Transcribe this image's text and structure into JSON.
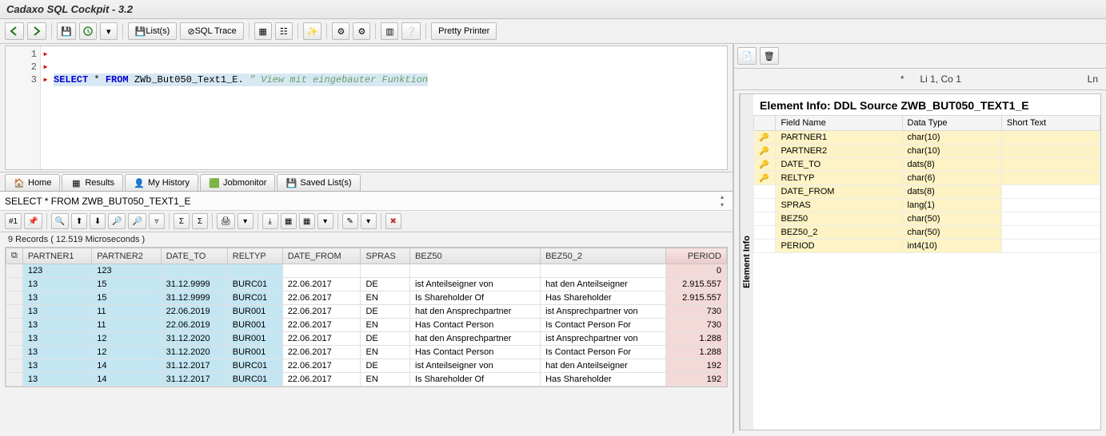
{
  "title": "Cadaxo SQL Cockpit - 3.2",
  "toolbar": {
    "lists": "List(s)",
    "sqltrace": "SQL Trace",
    "pretty": "Pretty Printer"
  },
  "editor": {
    "lines": {
      "l1": "1",
      "l2": "2",
      "l3": "3"
    },
    "code3": {
      "kw1": "SELECT",
      "kw2": "FROM",
      "star": "*",
      "ident": "ZWb_But050_Text1_E",
      "dot": ".",
      "comment": "\" View mit eingebauter Funktion"
    }
  },
  "tabs": {
    "home": "Home",
    "results": "Results",
    "history": "My History",
    "jobmon": "Jobmonitor",
    "saved": "Saved List(s)"
  },
  "query": "SELECT * FROM ZWB_BUT050_TEXT1_E",
  "resultmeta": "9 Records ( 12.519 Microseconds )",
  "columns": [
    "PARTNER1",
    "PARTNER2",
    "DATE_TO",
    "RELTYP",
    "DATE_FROM",
    "SPRAS",
    "BEZ50",
    "BEZ50_2",
    "PERIOD"
  ],
  "rows": [
    {
      "p1": "123",
      "p2": "123",
      "dto": "",
      "rel": "",
      "dfr": "",
      "spr": "",
      "b1": "",
      "b2": "",
      "per": "0"
    },
    {
      "p1": "13",
      "p2": "15",
      "dto": "31.12.9999",
      "rel": "BURC01",
      "dfr": "22.06.2017",
      "spr": "DE",
      "b1": "ist Anteilseigner von",
      "b2": "hat den Anteilseigner",
      "per": "2.915.557"
    },
    {
      "p1": "13",
      "p2": "15",
      "dto": "31.12.9999",
      "rel": "BURC01",
      "dfr": "22.06.2017",
      "spr": "EN",
      "b1": "Is Shareholder Of",
      "b2": "Has Shareholder",
      "per": "2.915.557"
    },
    {
      "p1": "13",
      "p2": "11",
      "dto": "22.06.2019",
      "rel": "BUR001",
      "dfr": "22.06.2017",
      "spr": "DE",
      "b1": "hat den Ansprechpartner",
      "b2": "ist Ansprechpartner von",
      "per": "730"
    },
    {
      "p1": "13",
      "p2": "11",
      "dto": "22.06.2019",
      "rel": "BUR001",
      "dfr": "22.06.2017",
      "spr": "EN",
      "b1": "Has Contact Person",
      "b2": "Is Contact Person For",
      "per": "730"
    },
    {
      "p1": "13",
      "p2": "12",
      "dto": "31.12.2020",
      "rel": "BUR001",
      "dfr": "22.06.2017",
      "spr": "DE",
      "b1": "hat den Ansprechpartner",
      "b2": "ist Ansprechpartner von",
      "per": "1.288"
    },
    {
      "p1": "13",
      "p2": "12",
      "dto": "31.12.2020",
      "rel": "BUR001",
      "dfr": "22.06.2017",
      "spr": "EN",
      "b1": "Has Contact Person",
      "b2": "Is Contact Person For",
      "per": "1.288"
    },
    {
      "p1": "13",
      "p2": "14",
      "dto": "31.12.2017",
      "rel": "BURC01",
      "dfr": "22.06.2017",
      "spr": "DE",
      "b1": "ist Anteilseigner von",
      "b2": "hat den Anteilseigner",
      "per": "192"
    },
    {
      "p1": "13",
      "p2": "14",
      "dto": "31.12.2017",
      "rel": "BURC01",
      "dfr": "22.06.2017",
      "spr": "EN",
      "b1": "Is Shareholder Of",
      "b2": "Has Shareholder",
      "per": "192"
    }
  ],
  "pos": {
    "star": "*",
    "line": "Li 1, Co 1",
    "ln": "Ln"
  },
  "elinfo": {
    "label": "Element Info",
    "title": "Element Info: DDL Source ZWB_BUT050_TEXT1_E",
    "cols": [
      "Field Name",
      "Data Type",
      "Short Text"
    ],
    "fields": [
      {
        "name": "PARTNER1",
        "dtype": "char(10)",
        "key": true
      },
      {
        "name": "PARTNER2",
        "dtype": "char(10)",
        "key": true
      },
      {
        "name": "DATE_TO",
        "dtype": "dats(8)",
        "key": true
      },
      {
        "name": "RELTYP",
        "dtype": "char(6)",
        "key": true
      },
      {
        "name": "DATE_FROM",
        "dtype": "dats(8)",
        "key": false
      },
      {
        "name": "SPRAS",
        "dtype": "lang(1)",
        "key": false
      },
      {
        "name": "BEZ50",
        "dtype": "char(50)",
        "key": false
      },
      {
        "name": "BEZ50_2",
        "dtype": "char(50)",
        "key": false
      },
      {
        "name": "PERIOD",
        "dtype": "int4(10)",
        "key": false
      }
    ]
  },
  "gridbtnlabel": "#1"
}
